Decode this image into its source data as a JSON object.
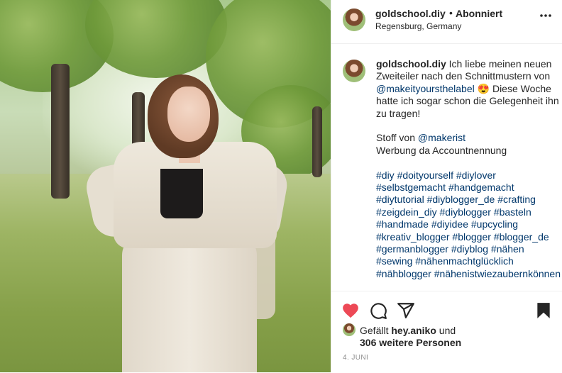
{
  "header": {
    "username": "goldschool.diy",
    "separator": "•",
    "follow_state": "Abonniert",
    "location": "Regensburg, Germany",
    "more_icon": "more-horizontal-icon"
  },
  "caption": {
    "username": "goldschool.diy",
    "text1": " Ich liebe meinen neuen Zweiteiler nach den Schnittmustern von ",
    "mention1": "@makeityoursthelabel",
    "emoji": "😍",
    "text2": " Diese Woche hatte ich sogar schon die Gelegenheit ihn zu tragen!",
    "line_fabric_prefix": "Stoff von ",
    "mention2": "@makerist",
    "line_ad": "Werbung da Accountnennung",
    "hashtags": "#diy #doityourself #diylover #selbstgemacht #handgemacht #diytutorial #diyblogger_de #crafting #zeigdein_diy #diyblogger #basteln #handmade #diyidee #upcycling #kreativ_blogger #blogger #blogger_de #germanblogger #diyblog #nähen #sewing #nähenmachtglücklich #nähblogger #nähenistwiezaubernkönnen"
  },
  "actions": {
    "icons": [
      "heart-icon",
      "comment-icon",
      "share-icon",
      "bookmark-icon"
    ],
    "heart_color": "#ed4956",
    "liked_by_prefix": "Gefällt ",
    "liked_by_user": "hey.aniko",
    "liked_by_suffix": " und",
    "others": "306 weitere Personen",
    "date": "4. JUNI"
  },
  "colors": {
    "link": "#00376b",
    "text": "#262626",
    "muted": "#8e8e8e",
    "divider": "#efefef"
  }
}
